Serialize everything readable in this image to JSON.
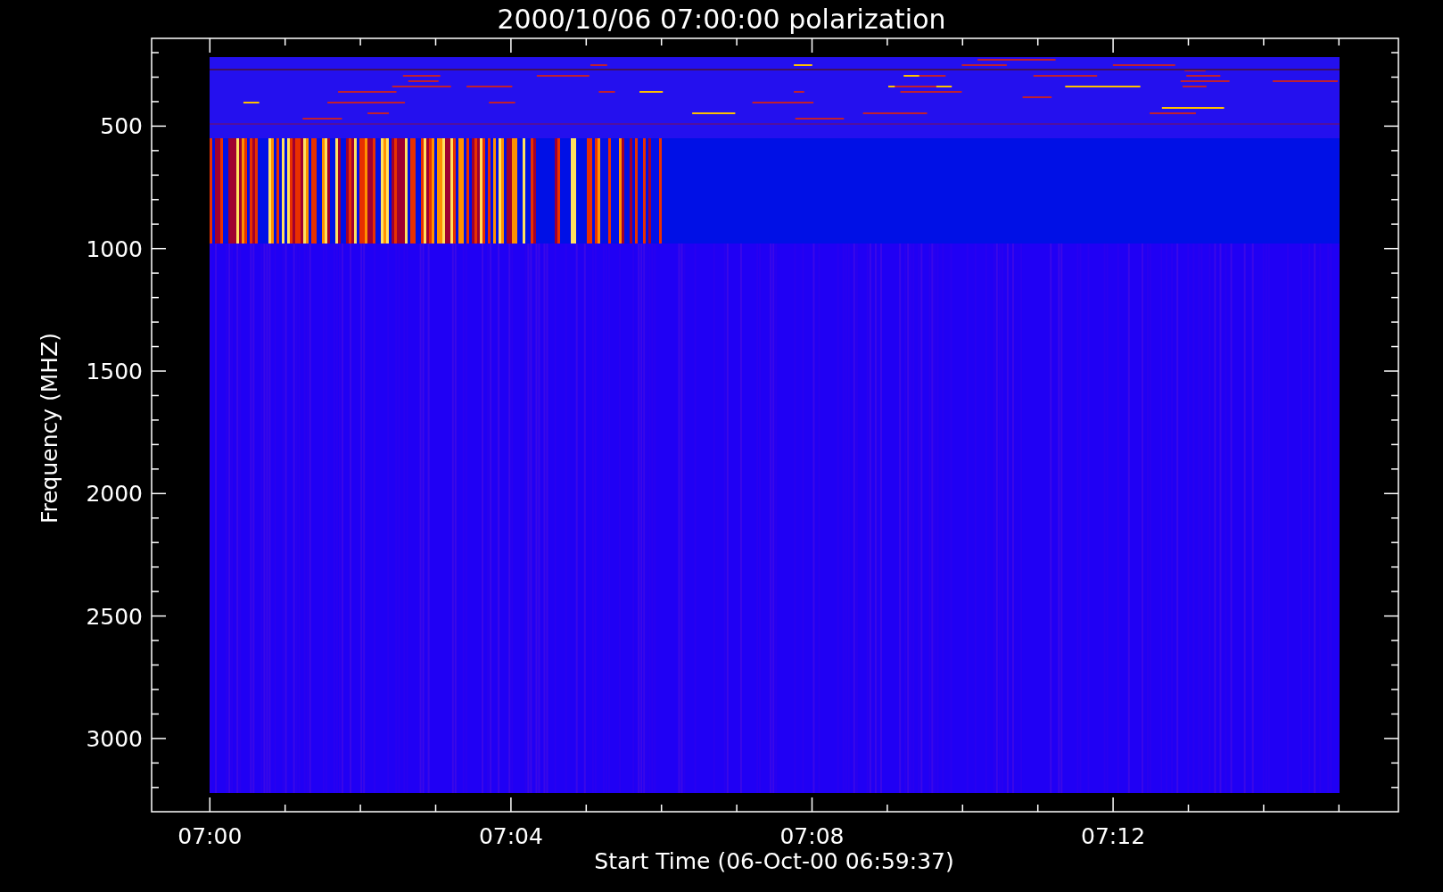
{
  "title": "2000/10/06 07:00:00 polarization",
  "ylabel": "Frequency (MHZ)",
  "xlabel": "Start Time (06-Oct-00 06:59:37)",
  "yticks": [
    "500",
    "1000",
    "1500",
    "2000",
    "2500",
    "3000"
  ],
  "xticks": [
    "07:00",
    "07:04",
    "07:08",
    "07:12"
  ]
}
